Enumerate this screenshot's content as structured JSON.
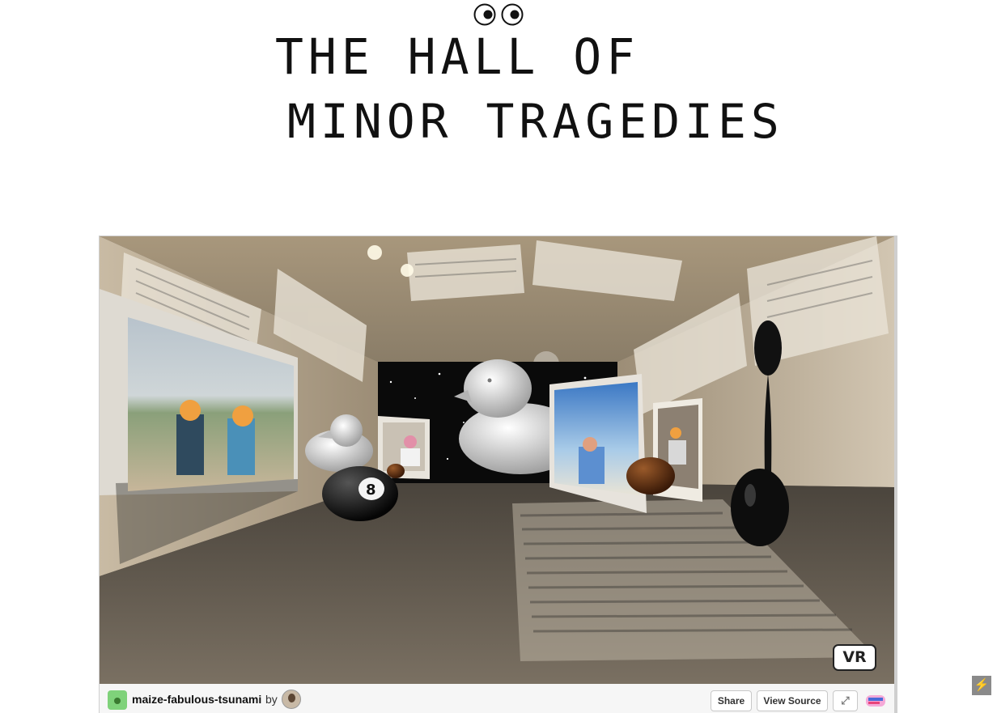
{
  "header": {
    "title_line1": "THE HALL OF",
    "title_line2": "MINOR TRAGEDIES",
    "decoration_icon": "googly-eyes"
  },
  "viewer": {
    "vr_label": "VR"
  },
  "project_bar": {
    "project_name": "maize-fabulous-tsunami",
    "by_text": "by",
    "share_label": "Share",
    "view_source_label": "View Source",
    "fullscreen_icon": "expand-icon",
    "logo_icon": "glitch-fish-logo"
  },
  "corner": {
    "icon": "lightning-bolt"
  },
  "colors": {
    "wall": "#b9a88d",
    "floor": "#6a6156",
    "void": "#0a0a0a",
    "vr_border": "#222222"
  }
}
